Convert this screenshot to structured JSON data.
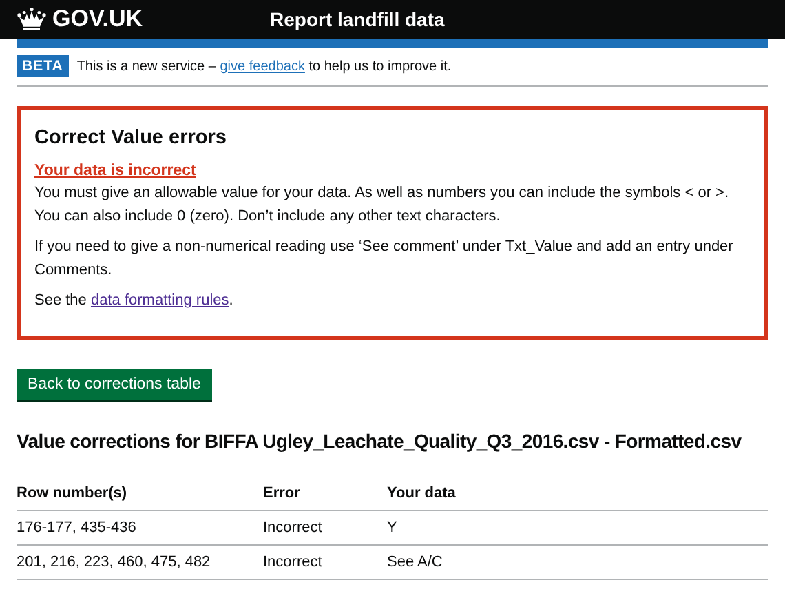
{
  "header": {
    "logo": "GOV.UK",
    "service": "Report landfill data"
  },
  "phase_banner": {
    "tag": "BETA",
    "text_before": "This is a new service – ",
    "link": "give feedback",
    "text_after": " to help us to improve it."
  },
  "error_summary": {
    "title": "Correct Value errors",
    "error_link": "Your data is incorrect",
    "paragraphs": [
      "You must give an allowable value for your data. As well as numbers you can include the symbols < or >. You can also include 0 (zero). Don’t include any other text characters.",
      "If you need to give a non-numerical reading use ‘See comment’ under Txt_Value and add an entry under Comments."
    ],
    "see": {
      "text_before": "See the ",
      "link": "data formatting rules",
      "text_after": "."
    }
  },
  "back_button": "Back to corrections table",
  "heading": "Value corrections for BIFFA Ugley_Leachate_Quality_Q3_2016.csv - Formatted.csv",
  "table": {
    "columns": [
      "Row number(s)",
      "Error",
      "Your data"
    ],
    "rows": [
      [
        "176-177, 435-436",
        "Incorrect",
        "Y"
      ],
      [
        "201, 216, 223, 460, 475, 482",
        "Incorrect",
        "See A/C"
      ]
    ]
  }
}
